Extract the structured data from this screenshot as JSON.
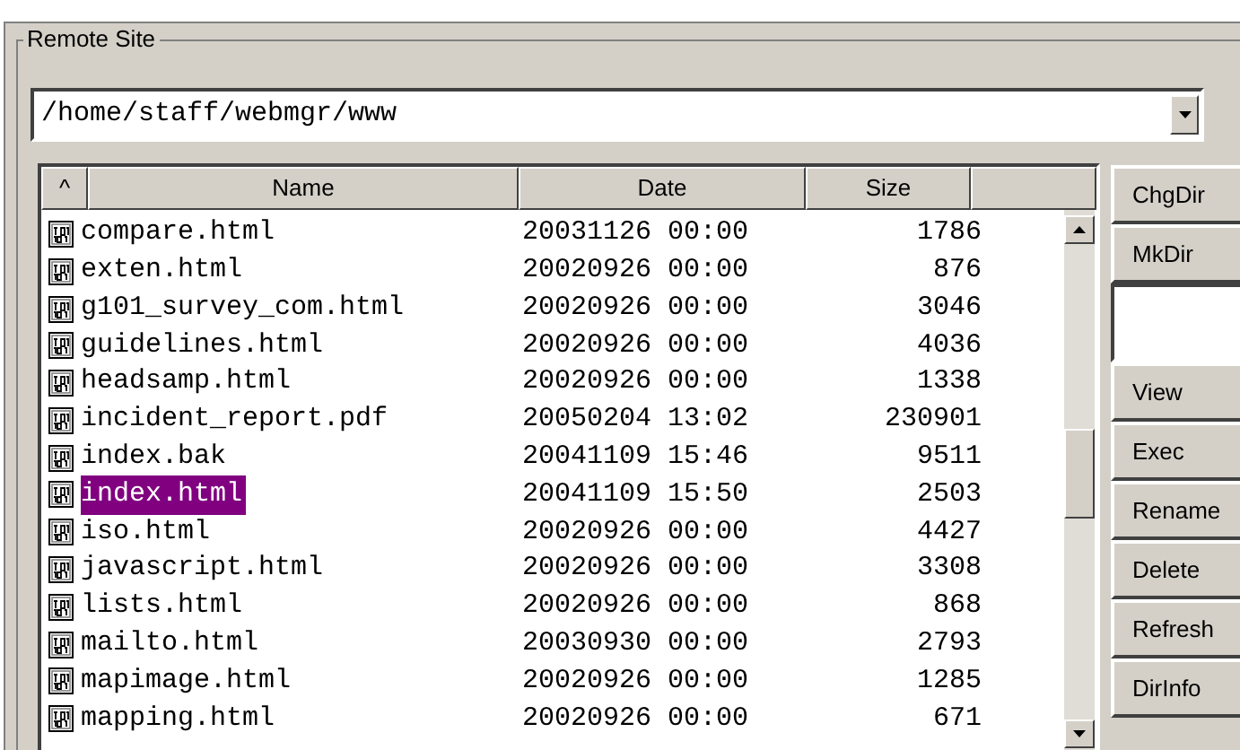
{
  "group": {
    "title": "Remote Site"
  },
  "path_combo": {
    "value": "/home/staff/webmgr/www"
  },
  "table": {
    "columns": [
      "^",
      "Name",
      "Date",
      "Size"
    ],
    "rows": [
      {
        "name": "compare.html",
        "date": "20031126 00:00",
        "size": "1786",
        "selected": false
      },
      {
        "name": "exten.html",
        "date": "20020926 00:00",
        "size": "876",
        "selected": false
      },
      {
        "name": "g101_survey_com.html",
        "date": "20020926 00:00",
        "size": "3046",
        "selected": false
      },
      {
        "name": "guidelines.html",
        "date": "20020926 00:00",
        "size": "4036",
        "selected": false
      },
      {
        "name": "headsamp.html",
        "date": "20020926 00:00",
        "size": "1338",
        "selected": false
      },
      {
        "name": "incident_report.pdf",
        "date": "20050204 13:02",
        "size": "230901",
        "selected": false
      },
      {
        "name": "index.bak",
        "date": "20041109 15:46",
        "size": "9511",
        "selected": false
      },
      {
        "name": "index.html",
        "date": "20041109 15:50",
        "size": "2503",
        "selected": true
      },
      {
        "name": "iso.html",
        "date": "20020926 00:00",
        "size": "4427",
        "selected": false
      },
      {
        "name": "javascript.html",
        "date": "20020926 00:00",
        "size": "3308",
        "selected": false
      },
      {
        "name": "lists.html",
        "date": "20020926 00:00",
        "size": "868",
        "selected": false
      },
      {
        "name": "mailto.html",
        "date": "20030930 00:00",
        "size": "2793",
        "selected": false
      },
      {
        "name": "mapimage.html",
        "date": "20020926 00:00",
        "size": "1285",
        "selected": false
      },
      {
        "name": "mapping.html",
        "date": "20020926 00:00",
        "size": "671",
        "selected": false
      }
    ]
  },
  "side_controls": [
    {
      "kind": "button",
      "label": "ChgDir"
    },
    {
      "kind": "button",
      "label": "MkDir"
    },
    {
      "kind": "field"
    },
    {
      "kind": "button",
      "label": "View"
    },
    {
      "kind": "button",
      "label": "Exec"
    },
    {
      "kind": "button",
      "label": "Rename"
    },
    {
      "kind": "button",
      "label": "Delete"
    },
    {
      "kind": "button",
      "label": "Refresh"
    },
    {
      "kind": "button",
      "label": "DirInfo"
    }
  ]
}
